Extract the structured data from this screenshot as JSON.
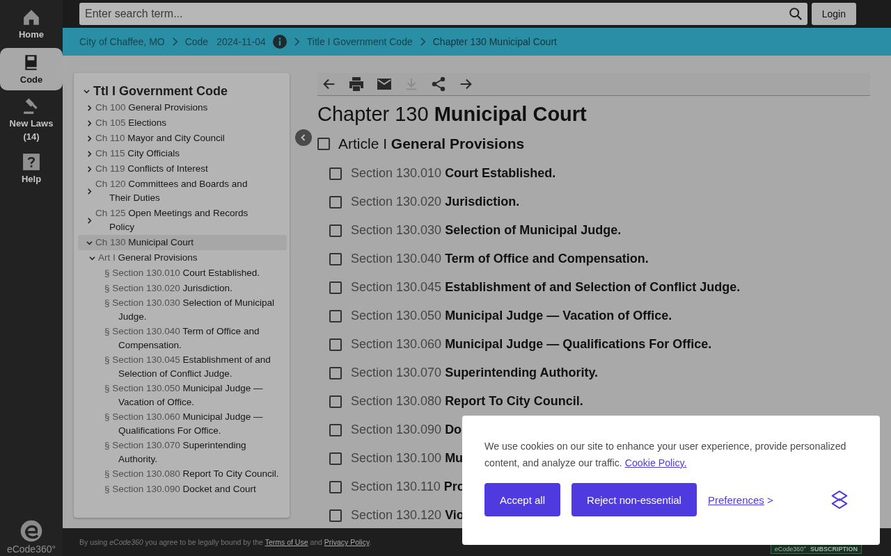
{
  "rail": {
    "items": [
      {
        "label": "Home",
        "kind": "home",
        "selected": false
      },
      {
        "label": "Code",
        "kind": "book",
        "selected": true
      },
      {
        "label": "New Laws (14)",
        "kind": "gavel",
        "selected": false
      },
      {
        "label": "Help",
        "kind": "help",
        "selected": false
      }
    ],
    "logo": "eCode360°"
  },
  "search": {
    "placeholder": "Enter search term..."
  },
  "login": "Login",
  "breadcrumb": [
    {
      "text": "City of Chaffee, MO",
      "kind": "link"
    },
    {
      "text": "Code",
      "kind": "link"
    },
    {
      "text": "2024-11-04",
      "kind": "version"
    },
    {
      "text": "Title I Government Code",
      "kind": "link"
    },
    {
      "text": "Chapter 130 Municipal Court",
      "kind": "current"
    }
  ],
  "toc": {
    "prefix": "Ttl I",
    "name": "Government Code",
    "expanded": true,
    "children": [
      {
        "prefix": "Ch 100",
        "name": "General Provisions",
        "expanded": false,
        "selected": false
      },
      {
        "prefix": "Ch 105",
        "name": "Elections",
        "expanded": false,
        "selected": false
      },
      {
        "prefix": "Ch 110",
        "name": "Mayor and City Council",
        "expanded": false,
        "selected": false
      },
      {
        "prefix": "Ch 115",
        "name": "City Officials",
        "expanded": false,
        "selected": false
      },
      {
        "prefix": "Ch 119",
        "name": "Conflicts of Interest",
        "expanded": false,
        "selected": false
      },
      {
        "prefix": "Ch 120",
        "name": "Committees and Boards and Their Duties",
        "expanded": false,
        "selected": false
      },
      {
        "prefix": "Ch 125",
        "name": "Open Meetings and Records Policy",
        "expanded": false,
        "selected": false
      },
      {
        "prefix": "Ch 130",
        "name": "Municipal Court",
        "expanded": true,
        "selected": true,
        "children": [
          {
            "prefix": "Art I",
            "name": "General Provisions",
            "expanded": true,
            "children": [
              {
                "prefix": "§ Section 130.010",
                "name": "Court Established."
              },
              {
                "prefix": "§ Section 130.020",
                "name": "Jurisdiction."
              },
              {
                "prefix": "§ Section 130.030",
                "name": "Selection of Municipal Judge."
              },
              {
                "prefix": "§ Section 130.040",
                "name": "Term of Office and Compensation."
              },
              {
                "prefix": "§ Section 130.045",
                "name": "Establishment of and Selection of Conflict Judge."
              },
              {
                "prefix": "§ Section 130.050",
                "name": "Municipal Judge — Vacation of Office."
              },
              {
                "prefix": "§ Section 130.060",
                "name": "Municipal Judge — Qualifications For Office."
              },
              {
                "prefix": "§ Section 130.070",
                "name": "Superintending Authority."
              },
              {
                "prefix": "§ Section 130.080",
                "name": "Report To City Council."
              },
              {
                "prefix": "§ Section 130.090",
                "name": "Docket and Court"
              }
            ]
          }
        ]
      }
    ]
  },
  "toolbar": [
    {
      "kind": "back",
      "disabled": false
    },
    {
      "kind": "print",
      "disabled": false
    },
    {
      "kind": "email",
      "disabled": false
    },
    {
      "kind": "download",
      "disabled": true
    },
    {
      "kind": "share",
      "disabled": false
    },
    {
      "kind": "forward",
      "disabled": false
    }
  ],
  "heading": {
    "prefix": "Chapter 130",
    "name": "Municipal Court"
  },
  "article": {
    "prefix": "Article I",
    "name": "General Provisions",
    "checked": false
  },
  "sections": [
    {
      "prefix": "Section 130.010",
      "name": "Court Established.",
      "checked": false
    },
    {
      "prefix": "Section 130.020",
      "name": "Jurisdiction.",
      "checked": false
    },
    {
      "prefix": "Section 130.030",
      "name": "Selection of Municipal Judge.",
      "checked": false
    },
    {
      "prefix": "Section 130.040",
      "name": "Term of Office and Compensation.",
      "checked": false
    },
    {
      "prefix": "Section 130.045",
      "name": "Establishment of and Selection of Conflict Judge.",
      "checked": false
    },
    {
      "prefix": "Section 130.050",
      "name": "Municipal Judge — Vacation of Office.",
      "checked": false
    },
    {
      "prefix": "Section 130.060",
      "name": "Municipal Judge — Qualifications For Office.",
      "checked": false
    },
    {
      "prefix": "Section 130.070",
      "name": "Superintending Authority.",
      "checked": false
    },
    {
      "prefix": "Section 130.080",
      "name": "Report To City Council.",
      "checked": false
    },
    {
      "prefix": "Section 130.090",
      "name": "Do",
      "checked": false
    },
    {
      "prefix": "Section 130.100",
      "name": "Mu",
      "checked": false
    },
    {
      "prefix": "Section 130.110",
      "name": "Pro",
      "checked": false
    },
    {
      "prefix": "Section 130.120",
      "name": "Vio",
      "checked": false
    }
  ],
  "footer": {
    "text": "By using *eCode360* you agree to be legally bound by the",
    "terms": "Terms of Use",
    "and": "and",
    "privacy": "Privacy Policy",
    "end": "."
  },
  "badge": {
    "brand": "eCode360°",
    "label": "SUBSCRIPTION"
  },
  "cookie": {
    "text": "We use cookies on our site to enhance your user experience, provide personalized content, and analyze our traffic.",
    "policy": "Cookie Policy.",
    "accept": "Accept all",
    "reject": "Reject non-essential",
    "preferences": "Preferences",
    "preferences_arrow": ">"
  }
}
